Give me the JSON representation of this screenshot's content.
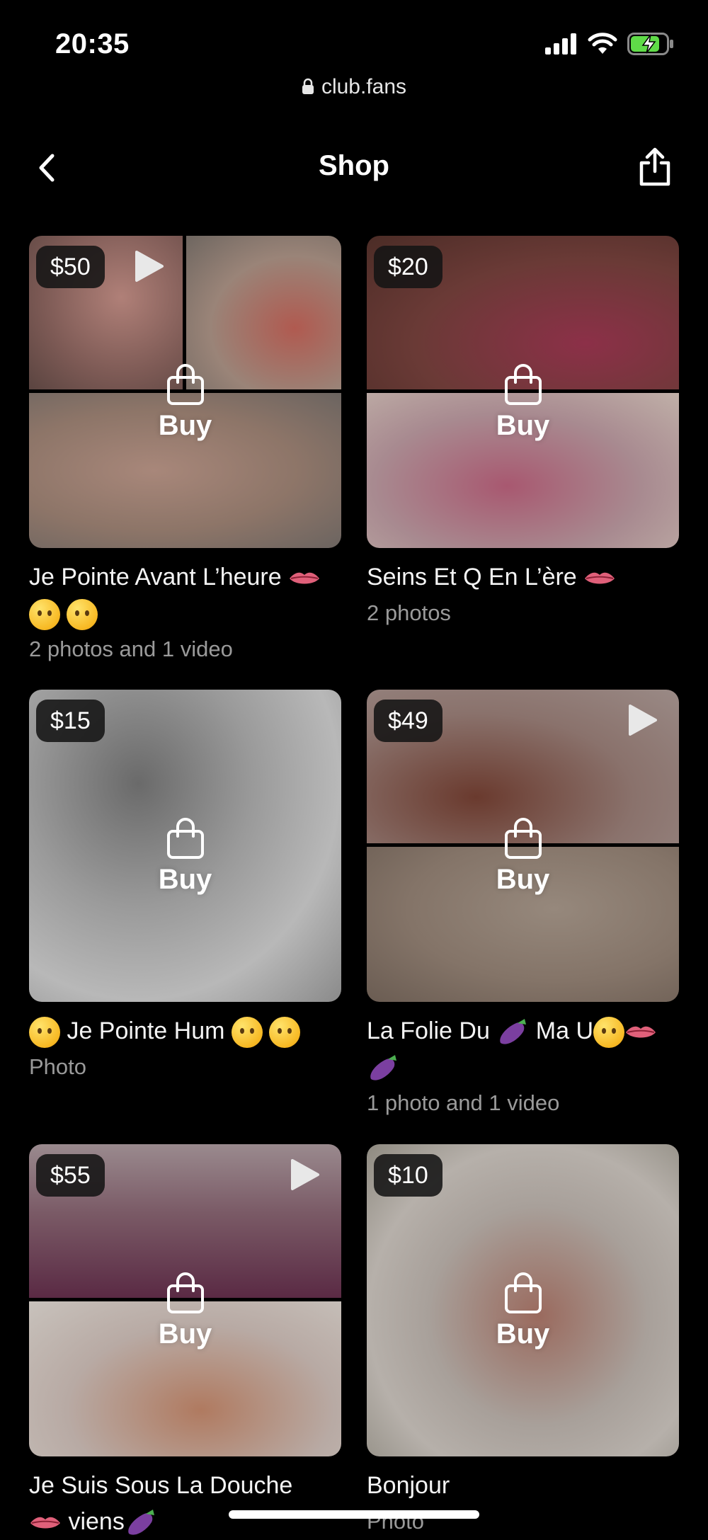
{
  "status_bar": {
    "time": "20:35"
  },
  "browser": {
    "url": "club.fans"
  },
  "nav": {
    "title": "Shop"
  },
  "buy_label": "Buy",
  "colors": {
    "background": "#000000",
    "subtitle": "#9a9a9a",
    "battery": "#5fdb48"
  },
  "products": [
    {
      "price": "$50",
      "has_video": true,
      "title": "Je Pointe Avant L’heure",
      "subtitle": "2 photos and 1 video"
    },
    {
      "price": "$20",
      "has_video": false,
      "title": "Seins Et Q En L’ère",
      "subtitle": "2 photos"
    },
    {
      "price": "$15",
      "has_video": false,
      "title": "Je Pointe Hum",
      "subtitle": "Photo"
    },
    {
      "price": "$49",
      "has_video": true,
      "title": "La Folie Du",
      "title_part2": "Ma U",
      "subtitle": "1 photo and 1 video"
    },
    {
      "price": "$55",
      "has_video": true,
      "title": "Je Suis Sous La Douche",
      "title_part2": "viens",
      "subtitle": ""
    },
    {
      "price": "$10",
      "has_video": false,
      "title": "Bonjour",
      "subtitle": "Photo"
    }
  ]
}
